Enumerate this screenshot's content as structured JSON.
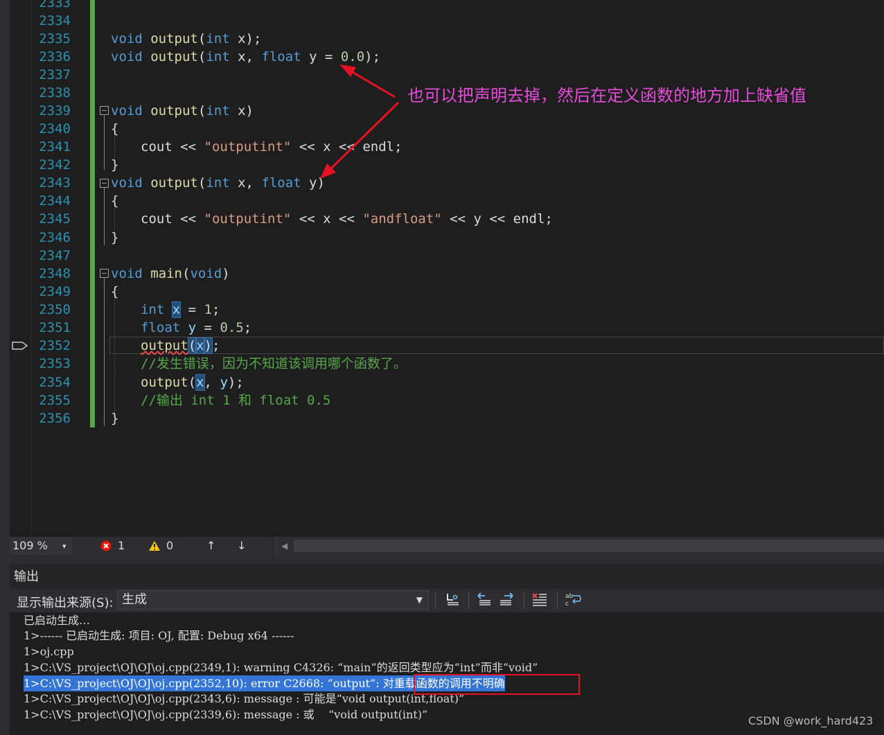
{
  "editor": {
    "partial_top_line": "2333",
    "line_numbers": [
      "2334",
      "2335",
      "2336",
      "2337",
      "2338",
      "2339",
      "2340",
      "2341",
      "2342",
      "2343",
      "2344",
      "2345",
      "2346",
      "2347",
      "2348",
      "2349",
      "2350",
      "2351",
      "2352",
      "2353",
      "2354",
      "2355",
      "2356"
    ],
    "annotation": "也可以把声明去掉，然后在定义函数的地方加上缺省值",
    "code": {
      "l2335": [
        "void",
        "output",
        "(",
        "int",
        " x);"
      ],
      "l2336": [
        "void",
        "output",
        "(",
        "int",
        " x, ",
        "float",
        " y = ",
        "0.0",
        ");"
      ],
      "l2339": [
        "void",
        "output",
        "(",
        "int",
        " x)"
      ],
      "l2340": "{",
      "l2341": [
        "cout",
        " << ",
        "\"outputint\"",
        " << x << ",
        "endl",
        ";"
      ],
      "l2342": "}",
      "l2343": [
        "void",
        "output",
        "(",
        "int",
        " x, ",
        "float",
        " y)"
      ],
      "l2344": "{",
      "l2345": [
        "cout",
        " << ",
        "\"outputint\"",
        " << x << ",
        "\"andfloat\"",
        " << y << ",
        "endl",
        ";"
      ],
      "l2346": "}",
      "l2348": [
        "void",
        "main",
        "(",
        "void",
        ")"
      ],
      "l2349": "{",
      "l2350": [
        "int",
        " ",
        "x",
        " = ",
        "1",
        ";"
      ],
      "l2351": [
        "float",
        " ",
        "y",
        " = ",
        "0.5",
        ";"
      ],
      "l2352": [
        "output",
        "(",
        "x",
        ")",
        ";"
      ],
      "l2353": "//发生错误，因为不知道该调用哪个函数了。",
      "l2354": [
        "output",
        "(",
        "x",
        ", ",
        "y",
        ");"
      ],
      "l2355": "//输出 int 1 和 float 0.5",
      "l2356": "}"
    }
  },
  "statusbar": {
    "zoom": "109 %",
    "zoom_caret": "▾",
    "errors_icon": "error-circle-icon",
    "errors": "1",
    "warnings_icon": "warning-triangle-icon",
    "warnings": "0",
    "up_arrow": "↑",
    "down_arrow": "↓",
    "scroll_left": "◀"
  },
  "output_panel": {
    "title": "输出",
    "source_label": "显示输出来源(S):",
    "source_value": "生成",
    "lines": [
      "已启动生成…",
      "1>------ 已启动生成: 项目: OJ, 配置: Debug x64 ------",
      "1>oj.cpp",
      "1>C:\\VS_project\\OJ\\OJ\\oj.cpp(2349,1): warning C4326: “main”的返回类型应为“int”而非“void”",
      "1>C:\\VS_project\\OJ\\OJ\\oj.cpp(2352,10): error C2668: “output”: 对重载函数的调用不明确",
      "1>C:\\VS_project\\OJ\\OJ\\oj.cpp(2343,6): message : 可能是“void output(int,float)”",
      "1>C:\\VS_project\\OJ\\OJ\\oj.cpp(2339,6): message : 或    “void output(int)”"
    ]
  },
  "watermark": "CSDN @work_hard423",
  "colors": {
    "keyword": "#569cd6",
    "function": "#dcdcaa",
    "string": "#d69d85",
    "comment": "#57a64a",
    "annotation": "#e44bd9",
    "selection": "#3375d6",
    "error_box": "#e81123"
  }
}
